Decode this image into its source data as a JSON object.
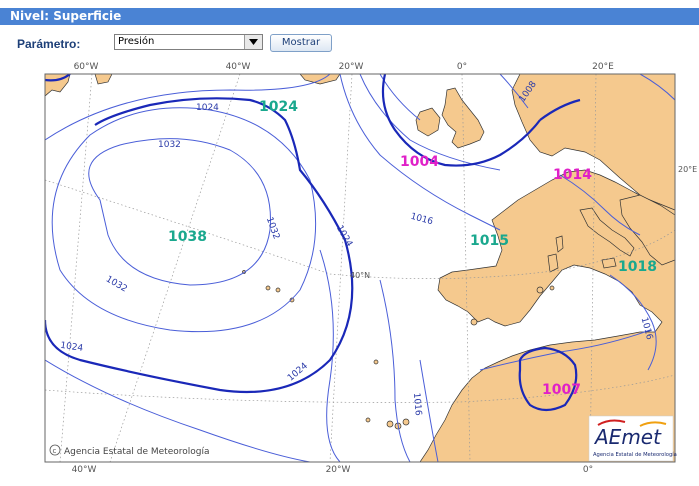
{
  "header": {
    "title": "Nivel: Superficie"
  },
  "controls": {
    "parameter_label": "Parámetro:",
    "parameter_selected": "Presión",
    "show_button": "Mostrar"
  },
  "map": {
    "top_longitudes": [
      "60°W",
      "40°W",
      "20°W",
      "0°",
      "20°E"
    ],
    "bottom_longitudes": [
      "40°W",
      "20°W",
      "0°"
    ],
    "latitude_labels": [
      "40°N",
      "20°E"
    ],
    "pressure_centers": [
      {
        "value": "1038",
        "type": "high"
      },
      {
        "value": "1024",
        "type": "high"
      },
      {
        "value": "1004",
        "type": "low"
      },
      {
        "value": "1014",
        "type": "low"
      },
      {
        "value": "1015",
        "type": "high"
      },
      {
        "value": "1018",
        "type": "high"
      },
      {
        "value": "1007",
        "type": "low"
      }
    ],
    "isobar_labels": [
      "1024",
      "1032",
      "1032",
      "1032",
      "1024",
      "1024",
      "1024",
      "1016",
      "1016",
      "1016",
      "1008"
    ],
    "copyright": "Agencia Estatal de Meteorología",
    "logo_text": "AEmet",
    "logo_subtitle": "Agencia Estatal de Meteorología",
    "colors": {
      "high": "#1aa88e",
      "low": "#e020c8",
      "isobar": "#4a5ed8",
      "isobar_bold": "#1a28b8",
      "land": "#f5c98e",
      "sea": "#ffffff",
      "header": "#4a83d4"
    }
  }
}
